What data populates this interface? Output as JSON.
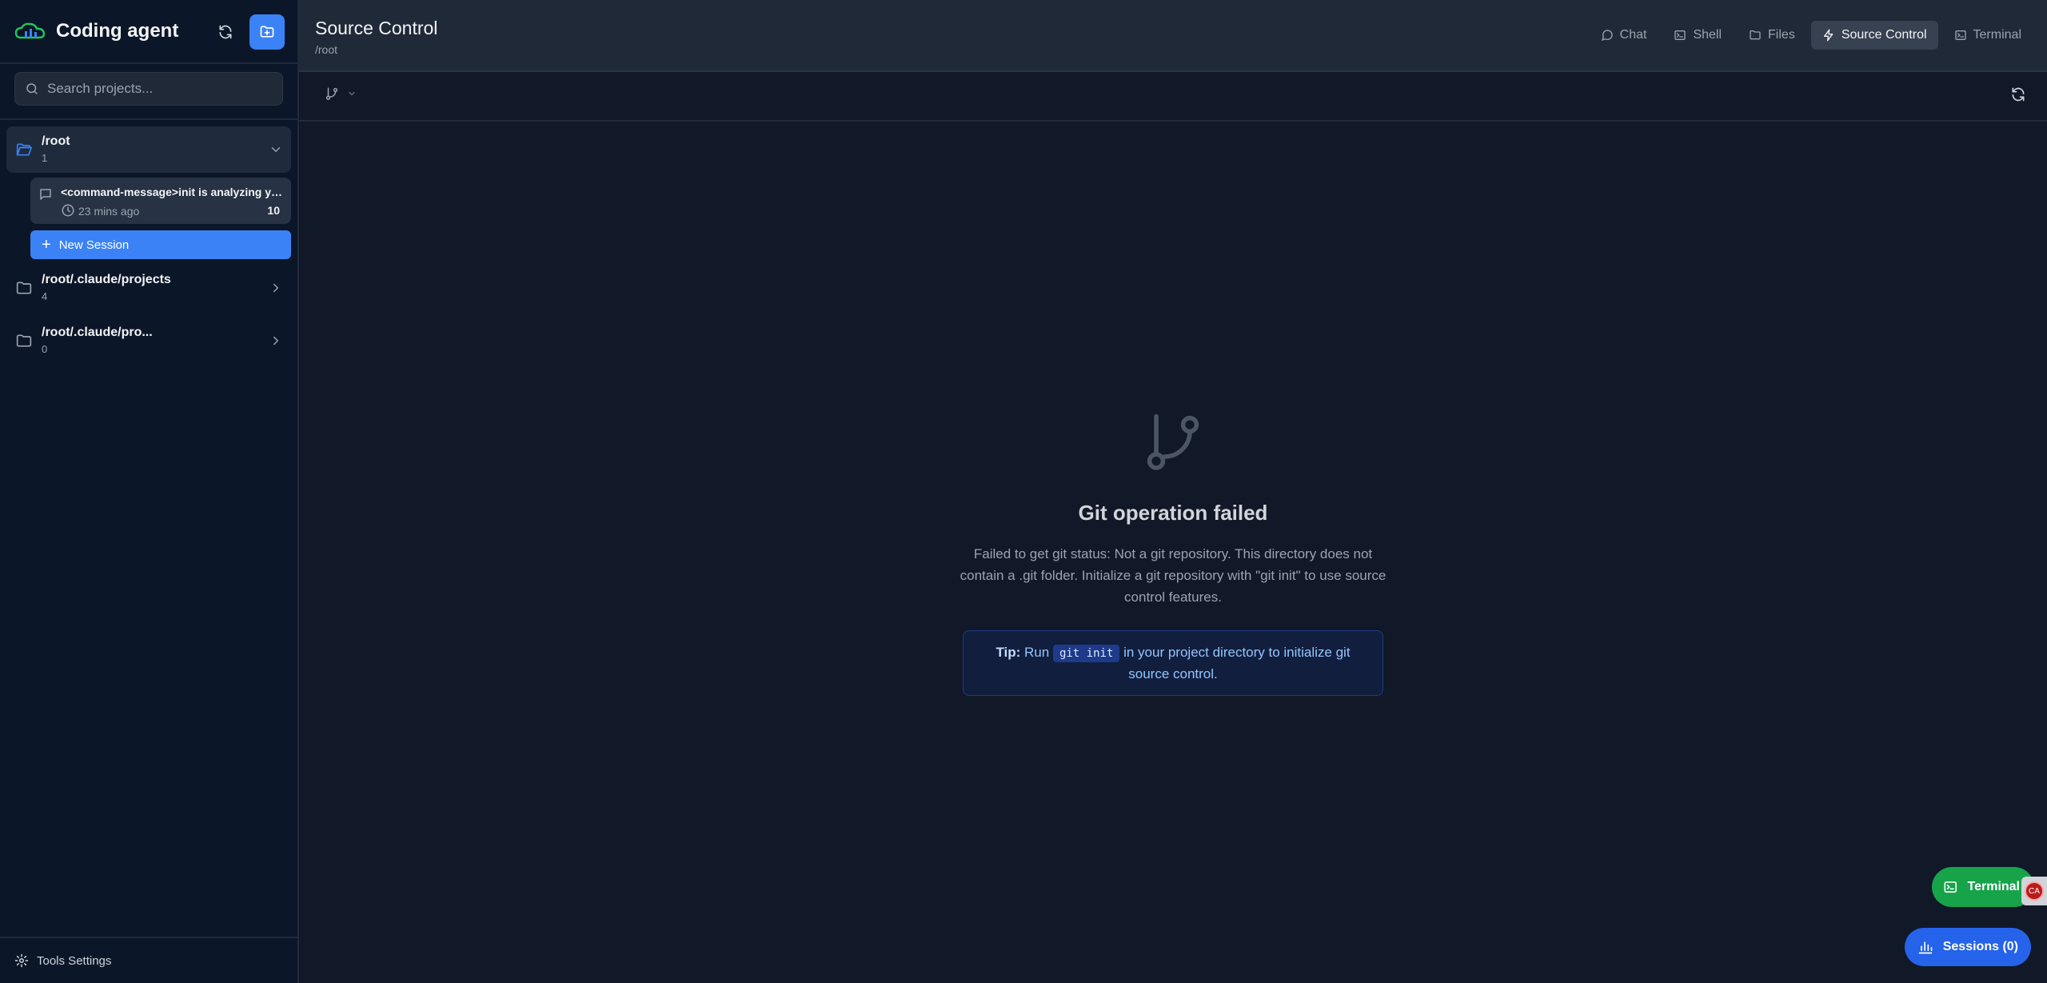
{
  "app": {
    "title": "Coding agent"
  },
  "sidebar": {
    "search_placeholder": "Search projects...",
    "projects": [
      {
        "name": "/root",
        "count": "1",
        "expanded": true
      },
      {
        "name": "/root/.claude/projects",
        "count": "4",
        "expanded": false
      },
      {
        "name": "/root/.claude/pro...",
        "count": "0",
        "expanded": false
      }
    ],
    "session": {
      "title": "<command-message>init is analyzing yo...",
      "time": "23 mins ago",
      "count": "10"
    },
    "new_session_label": "New Session",
    "footer_label": "Tools Settings"
  },
  "header": {
    "title": "Source Control",
    "subtitle": "/root",
    "tabs": [
      {
        "label": "Chat",
        "icon": "chat-icon",
        "active": false
      },
      {
        "label": "Shell",
        "icon": "shell-icon",
        "active": false
      },
      {
        "label": "Files",
        "icon": "folder-icon",
        "active": false
      },
      {
        "label": "Source Control",
        "icon": "source-control-icon",
        "active": true
      },
      {
        "label": "Terminal",
        "icon": "terminal-icon",
        "active": false
      }
    ]
  },
  "main": {
    "error_title": "Git operation failed",
    "error_message": "Failed to get git status: Not a git repository. This directory does not contain a .git folder. Initialize a git repository with \"git init\" to use source control features.",
    "tip": {
      "label": "Tip:",
      "before": " Run ",
      "code": "git init",
      "after": " in your project directory to initialize git source control."
    }
  },
  "floating": {
    "terminal_label": "Terminal",
    "sessions_label": "Sessions (0)",
    "avatar_text": "CA"
  },
  "colors": {
    "accent": "#3b82f6",
    "success": "#16a34a",
    "background": "#111827",
    "sidebar": "#0b1628"
  }
}
